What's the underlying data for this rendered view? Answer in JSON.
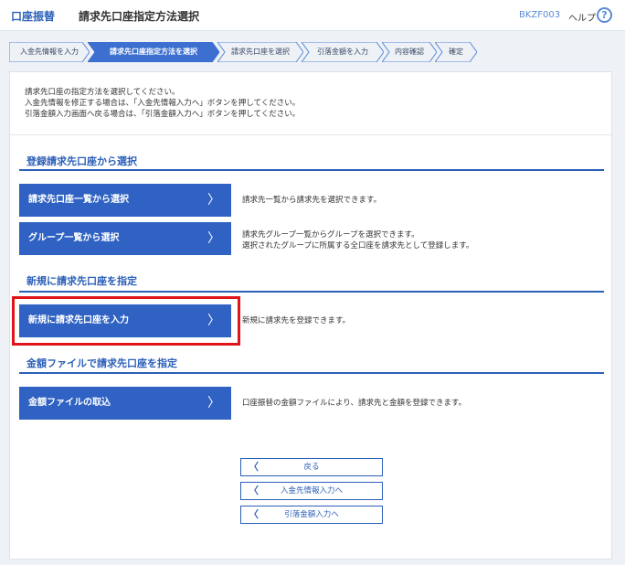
{
  "header": {
    "breadcrumb": "口座振替",
    "title": "請求先口座指定方法選択",
    "screen_id": "BKZF003",
    "help_label": "ヘルプ",
    "help_icon": "?"
  },
  "steps": [
    {
      "label": "入金先情報を入力",
      "active": false
    },
    {
      "label": "請求先口座指定方法を選択",
      "active": true
    },
    {
      "label": "請求先口座を選択",
      "active": false
    },
    {
      "label": "引落金額を入力",
      "active": false
    },
    {
      "label": "内容確認",
      "active": false
    },
    {
      "label": "確定",
      "active": false
    }
  ],
  "intro": {
    "line1": "請求先口座の指定方法を選択してください。",
    "line2": "入金先情報を修正する場合は、「入金先情報入力へ」ボタンを押してください。",
    "line3": "引落金額入力画面へ戻る場合は、「引落金額入力へ」ボタンを押してください。"
  },
  "sections": {
    "registered": {
      "title": "登録請求先口座から選択",
      "list_button": "請求先口座一覧から選択",
      "list_desc": "請求先一覧から請求先を選択できます。",
      "group_button": "グループ一覧から選択",
      "group_desc1": "請求先グループ一覧からグループを選択できます。",
      "group_desc2": "選択されたグループに所属する全口座を請求先として登録します。"
    },
    "new": {
      "title": "新規に請求先口座を指定",
      "input_button": "新規に請求先口座を入力",
      "input_desc": "新規に請求先を登録できます。"
    },
    "file": {
      "title": "金額ファイルで請求先口座を指定",
      "import_button": "金額ファイルの取込",
      "import_desc": "口座振替の金額ファイルにより、請求先と金額を登録できます。"
    }
  },
  "icons": {
    "chevron_right": "〉",
    "chevron_left": "〈"
  },
  "footer": {
    "back": "戻る",
    "to_payee": "入金先情報入力へ",
    "to_amount": "引落金額入力へ"
  },
  "colors": {
    "primary": "#2f62c3",
    "highlight": "#e0141b"
  }
}
